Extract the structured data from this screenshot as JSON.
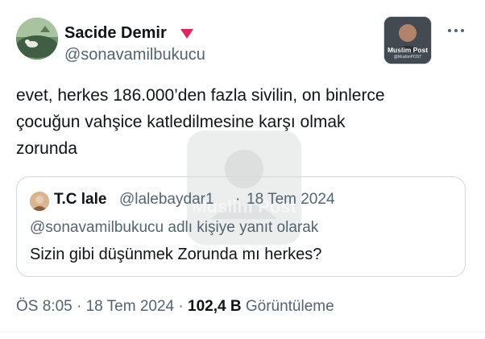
{
  "tweet": {
    "author": {
      "display_name": "Sacide Demir",
      "handle": "@sonavamilbukucu",
      "avatar_icon": "avatar-landscape",
      "emoji_icon": "red-heart-triangle-icon"
    },
    "badge": {
      "title": "Muslim Post",
      "subtitle": "@MuslimPOST"
    },
    "more_icon": "more-options-icon",
    "text": "evet, herkes 186.000’den fazla sivilin, on binlerce\nçocuğun vahşice katledilmesine karşı olmak\nzorunda",
    "watermark": "Muslim Post",
    "quoted": {
      "display_name": "T.C lale",
      "handle": "@lalebaydar1",
      "separator": "·",
      "date": "18 Tem 2024",
      "reply_context": "@sonavamilbukucu adlı kişiye yanıt olarak",
      "text": "Sizin gibi düşünmek Zorunda mı herkes?"
    },
    "meta": {
      "time": "ÖS 8:05",
      "sep1": "·",
      "date": "18 Tem 2024",
      "sep2": "·",
      "views_count": "102,4 B",
      "views_label": "Görüntüleme"
    }
  },
  "colors": {
    "text": "#0f1419",
    "secondary": "#536471",
    "border": "#cfd9de",
    "heart": "#e0245e"
  }
}
